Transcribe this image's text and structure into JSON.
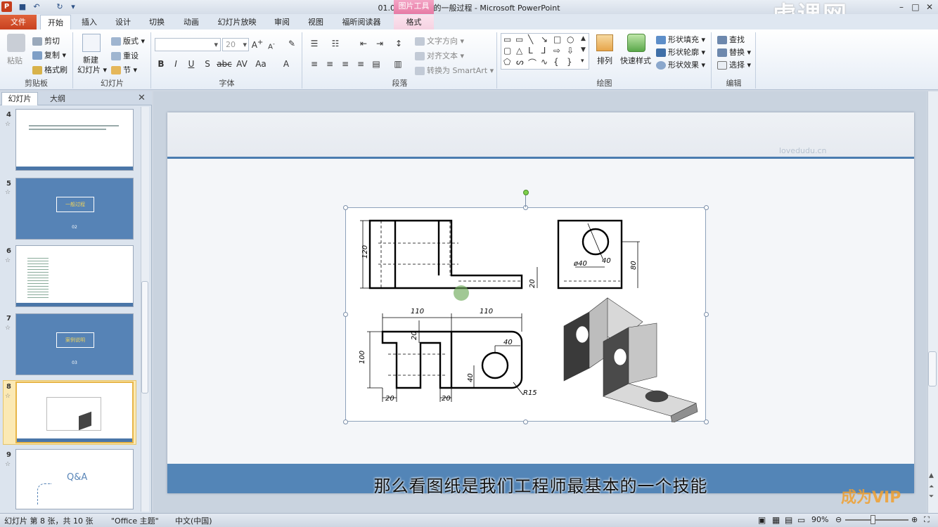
{
  "window": {
    "title": "01.05 模型创建的一般过程 - Microsoft PowerPoint",
    "contextual_tab_group": "图片工具",
    "watermark": "虎课网"
  },
  "tabs": {
    "file": "文件",
    "items": [
      "开始",
      "插入",
      "设计",
      "切换",
      "动画",
      "幻灯片放映",
      "审阅",
      "视图",
      "福昕阅读器"
    ],
    "format": "格式"
  },
  "ribbon": {
    "clipboard": {
      "label": "剪贴板",
      "paste": "粘贴",
      "cut": "剪切",
      "copy": "复制",
      "format_painter": "格式刷"
    },
    "slides": {
      "label": "幻灯片",
      "new_slide_1": "新建",
      "new_slide_2": "幻灯片",
      "layout": "版式",
      "reset": "重设",
      "section": "节"
    },
    "font": {
      "label": "字体",
      "font_size": "20"
    },
    "paragraph": {
      "label": "段落",
      "text_direction": "文字方向",
      "align_text": "对齐文本",
      "convert_smartart": "转换为 SmartArt"
    },
    "drawing": {
      "label": "绘图",
      "arrange": "排列",
      "quick_styles": "快速样式",
      "shape_fill": "形状填充",
      "shape_outline": "形状轮廓",
      "shape_effects": "形状效果"
    },
    "editing": {
      "label": "编辑",
      "find": "查找",
      "replace": "替换",
      "select": "选择"
    }
  },
  "pane": {
    "tab_slides": "幻灯片",
    "tab_outline": "大纲",
    "slides": [
      {
        "num": "4"
      },
      {
        "num": "5",
        "title": "一般过程",
        "sub": "02"
      },
      {
        "num": "6"
      },
      {
        "num": "7",
        "title": "案例说明",
        "sub": "03"
      },
      {
        "num": "8"
      },
      {
        "num": "9",
        "title": "Q&A"
      }
    ]
  },
  "slide": {
    "logo_text": "lovedudu.cn",
    "subtitle": "那么看图纸是我们工程师最基本的一个技能",
    "vip_badge": "成为VIP"
  },
  "drawing": {
    "dims": {
      "d120": "120",
      "d20a": "20",
      "d40a": "ø40",
      "d40b": "40",
      "d80": "80",
      "d110a": "110",
      "d110b": "110",
      "d20b": "20",
      "d100": "100",
      "d40c": "40",
      "d40d": "40",
      "d20c": "20",
      "d20d": "20",
      "r15": "R15"
    }
  },
  "status": {
    "slide_info": "幻灯片 第 8 张，共 10 张",
    "theme": "\"Office 主题\"",
    "language": "中文(中国)",
    "zoom": "90%"
  }
}
